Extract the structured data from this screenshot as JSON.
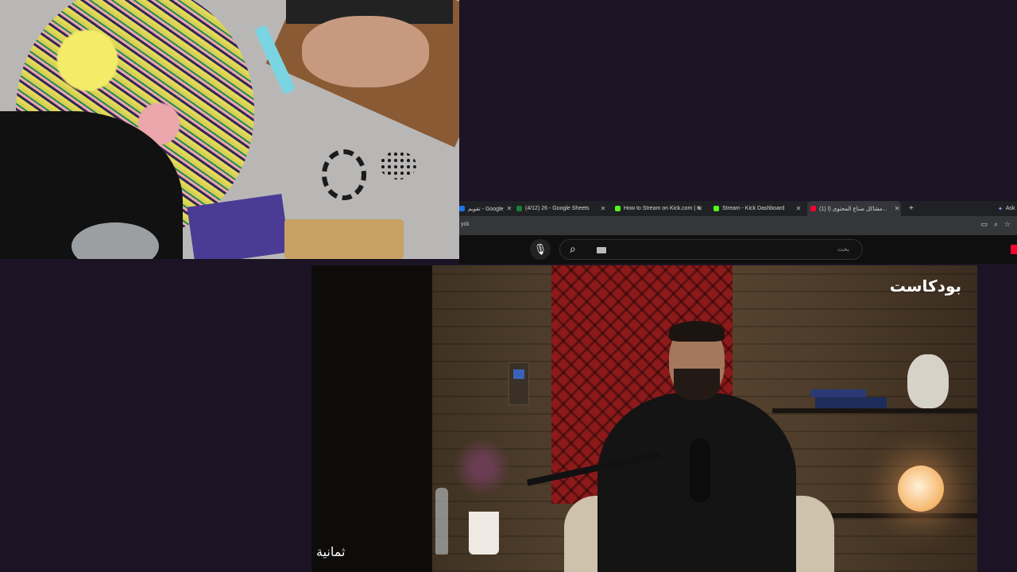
{
  "browser": {
    "tabs": [
      {
        "title": "تقويم - Google",
        "fav_color": "#1a73e8",
        "active": false
      },
      {
        "title": "(4/12) 26 - Google Sheets",
        "fav_color": "#188038",
        "active": false
      },
      {
        "title": "How to Stream on Kick.com | K",
        "fav_color": "#53fc18",
        "active": false
      },
      {
        "title": "Stream - Kick Dashboard",
        "fav_color": "#53fc18",
        "active": false
      },
      {
        "title": "(1) مشاكل صناع المحتوى (ا...",
        "fav_color": "#ff0033",
        "active": true
      }
    ],
    "new_tab": "+",
    "ask_label": "Ask",
    "url_fragment": "yck",
    "tab_close": "✕"
  },
  "youtube": {
    "search_placeholder": "بحث",
    "mic_icon": "microphone-icon",
    "search_icon": "search-icon"
  },
  "video": {
    "logo_top_right": "بودكاست",
    "logo_bottom_left": "ثمانية"
  }
}
